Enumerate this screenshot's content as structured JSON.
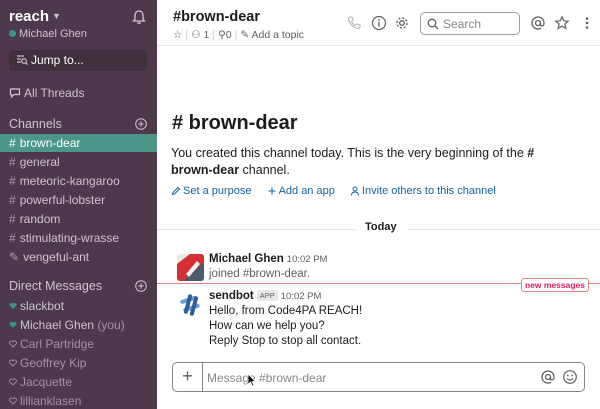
{
  "colors": {
    "sidebar_bg": "#4d394b",
    "active_channel": "#4c9689",
    "link": "#1264a3",
    "new_messages": "#e01e5a",
    "presence_active": "#38978d"
  },
  "sidebar": {
    "team_name": "reach",
    "user_name": "Michael Ghen",
    "jump_to": "Jump to...",
    "all_threads": "All Threads",
    "channels_header": "Channels",
    "channels": [
      {
        "name": "brown-dear",
        "icon": "hash",
        "active": true
      },
      {
        "name": "general",
        "icon": "hash"
      },
      {
        "name": "meteoric-kangaroo",
        "icon": "hash"
      },
      {
        "name": "powerful-lobster",
        "icon": "hash"
      },
      {
        "name": "random",
        "icon": "hash"
      },
      {
        "name": "stimulating-wrasse",
        "icon": "hash"
      },
      {
        "name": "vengeful-ant",
        "icon": "pencil-icon"
      }
    ],
    "dm_header": "Direct Messages",
    "dms": [
      {
        "name": "slackbot",
        "icon": "heart-icon",
        "suffix": ""
      },
      {
        "name": "Michael Ghen",
        "icon": "presence-active",
        "suffix": "(you)"
      },
      {
        "name": "Carl Partridge",
        "icon": "presence-away",
        "suffix": ""
      },
      {
        "name": "Geoffrey Kip",
        "icon": "presence-away",
        "suffix": ""
      },
      {
        "name": "Jacquette",
        "icon": "presence-away",
        "suffix": ""
      },
      {
        "name": "lillianklasen",
        "icon": "presence-away",
        "suffix": ""
      }
    ]
  },
  "header": {
    "channel": "#brown-dear",
    "members": "1",
    "pins": "0",
    "add_topic": "Add a topic",
    "search_placeholder": "Search"
  },
  "intro": {
    "title": "# brown-dear",
    "text_prefix": "You created this channel today. This is the very beginning of the ",
    "text_channel": "# brown-dear",
    "text_suffix": " channel.",
    "actions": [
      "Set a purpose",
      "Add an app",
      "Invite others to this channel"
    ]
  },
  "divider_label": "Today",
  "messages": [
    {
      "author": "Michael Ghen",
      "time": "10:02 PM",
      "badge": "",
      "lines": [
        "joined #brown-dear."
      ],
      "system": true
    },
    {
      "author": "sendbot",
      "time": "10:02 PM",
      "badge": "APP",
      "lines": [
        "Hello, from Code4PA REACH!",
        "How can we help you?",
        "Reply Stop to stop all contact."
      ],
      "system": false
    }
  ],
  "new_messages_label": "new messages",
  "composer": {
    "placeholder": "Message #brown-dear"
  }
}
